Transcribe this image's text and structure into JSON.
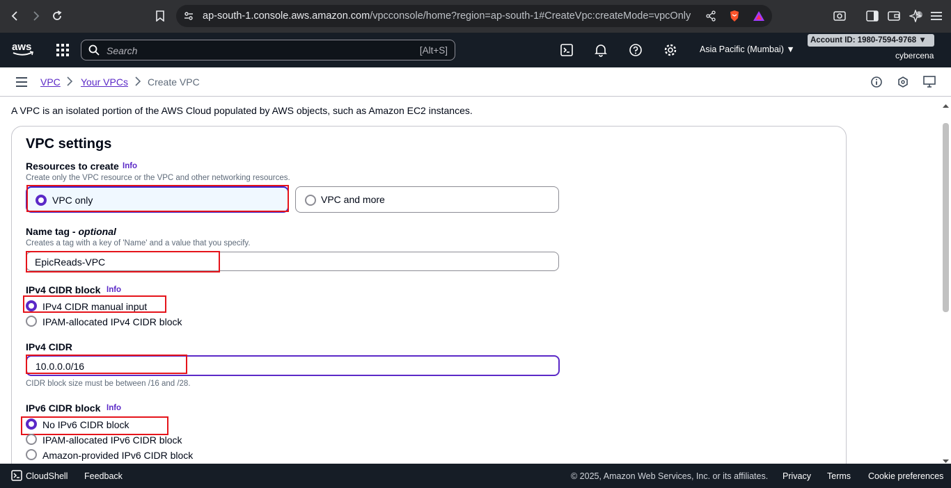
{
  "browser": {
    "url_domain": "ap-south-1.console.aws.amazon.com",
    "url_path": "/vpcconsole/home?region=ap-south-1#CreateVpc:createMode=vpcOnly",
    "brave_count": "8"
  },
  "aws_nav": {
    "logo_text": "aws",
    "search_placeholder": "Search",
    "search_shortcut": "[Alt+S]",
    "region": "Asia Pacific (Mumbai)",
    "account_id": "Account ID: 1980-7594-9768",
    "user": "cybercena"
  },
  "breadcrumb": {
    "items": [
      "VPC",
      "Your VPCs",
      "Create VPC"
    ]
  },
  "intro": "A VPC is an isolated portion of the AWS Cloud populated by AWS objects, such as Amazon EC2 instances.",
  "vpc_settings": {
    "title": "VPC settings",
    "resources": {
      "label": "Resources to create",
      "info": "Info",
      "description": "Create only the VPC resource or the VPC and other networking resources.",
      "options": [
        "VPC only",
        "VPC and more"
      ],
      "selected": "VPC only"
    },
    "name_tag": {
      "label": "Name tag - ",
      "label_optional": "optional",
      "description": "Creates a tag with a key of 'Name' and a value that you specify.",
      "value": "EpicReads-VPC"
    },
    "ipv4_block": {
      "label": "IPv4 CIDR block",
      "info": "Info",
      "options": [
        "IPv4 CIDR manual input",
        "IPAM-allocated IPv4 CIDR block"
      ],
      "selected": "IPv4 CIDR manual input"
    },
    "ipv4_cidr": {
      "label": "IPv4 CIDR",
      "value": "10.0.0.0/16",
      "hint": "CIDR block size must be between /16 and /28."
    },
    "ipv6_block": {
      "label": "IPv6 CIDR block",
      "info": "Info",
      "options": [
        "No IPv6 CIDR block",
        "IPAM-allocated IPv6 CIDR block",
        "Amazon-provided IPv6 CIDR block"
      ],
      "selected": "No IPv6 CIDR block"
    }
  },
  "footer": {
    "cloudshell": "CloudShell",
    "feedback": "Feedback",
    "copyright": "© 2025, Amazon Web Services, Inc. or its affiliates.",
    "privacy": "Privacy",
    "terms": "Terms",
    "cookies": "Cookie preferences"
  },
  "colors": {
    "aws_nav_bg": "#161d26",
    "accent_purple": "#5b29c7",
    "highlight_red": "#e5141b"
  }
}
